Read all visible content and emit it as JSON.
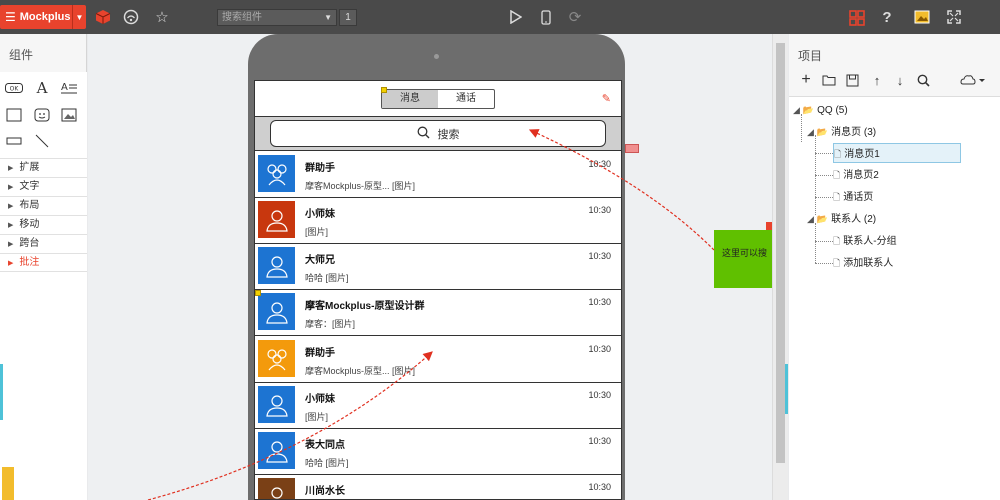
{
  "toolbar": {
    "logo_text": "Mockplus",
    "search_placeholder": "搜索组件",
    "page_number": "1",
    "icons": [
      "cube-icon",
      "cloud-icon",
      "star-icon",
      "play-icon",
      "phone-icon",
      "refresh-icon",
      "grid-icon",
      "help-icon",
      "image-icon",
      "fullscreen-icon"
    ]
  },
  "left_panel": {
    "title": "组件",
    "categories": [
      {
        "label": "扩展",
        "active": false
      },
      {
        "label": "文字",
        "active": false
      },
      {
        "label": "布局",
        "active": false
      },
      {
        "label": "移动",
        "active": false
      },
      {
        "label": "跨台",
        "active": false
      },
      {
        "label": "批注",
        "active": true
      }
    ]
  },
  "phone": {
    "tabs": [
      {
        "label": "消息",
        "active": true
      },
      {
        "label": "通话",
        "active": false
      }
    ],
    "search_label": "搜索",
    "rows": [
      {
        "name": "群助手",
        "message": "摩客Mockplus-原型... [图片]",
        "time": "10:30",
        "avatar_color": "#1d74d2",
        "avatar_type": "group"
      },
      {
        "name": "小师妹",
        "message": "[图片]",
        "time": "10:30",
        "avatar_color": "#c8370e",
        "avatar_type": "person"
      },
      {
        "name": "大师兄",
        "message": "哈哈 [图片]",
        "time": "10:30",
        "avatar_color": "#1d74d2",
        "avatar_type": "person"
      },
      {
        "name": "摩客Mockplus-原型设计群",
        "message": "摩客：[图片]",
        "time": "10:30",
        "avatar_color": "#1d74d2",
        "avatar_type": "person"
      },
      {
        "name": "群助手",
        "message": "摩客Mockplus-原型... [图片]",
        "time": "10:30",
        "avatar_color": "#f39a0c",
        "avatar_type": "group"
      },
      {
        "name": "小师妹",
        "message": "[图片]",
        "time": "10:30",
        "avatar_color": "#1d74d2",
        "avatar_type": "person"
      },
      {
        "name": "表大同点",
        "message": "哈哈 [图片]",
        "time": "10:30",
        "avatar_color": "#1d74d2",
        "avatar_type": "person"
      },
      {
        "name": "川尚水长",
        "message": "",
        "time": "10:30",
        "avatar_color": "#7a4016",
        "avatar_type": "person"
      }
    ]
  },
  "annotation": {
    "green_note_text": "这里可以搜"
  },
  "right_panel": {
    "title": "项目",
    "tree": [
      {
        "label": "QQ (5)",
        "level": 0,
        "type": "folder"
      },
      {
        "label": "消息页 (3)",
        "level": 1,
        "type": "folder"
      },
      {
        "label": "消息页1",
        "level": 2,
        "type": "page",
        "selected": true
      },
      {
        "label": "消息页2",
        "level": 2,
        "type": "page"
      },
      {
        "label": "通话页",
        "level": 2,
        "type": "page"
      },
      {
        "label": "联系人 (2)",
        "level": 1,
        "type": "folder"
      },
      {
        "label": "联系人-分组",
        "level": 2,
        "type": "page"
      },
      {
        "label": "添加联系人",
        "level": 2,
        "type": "page"
      }
    ]
  }
}
